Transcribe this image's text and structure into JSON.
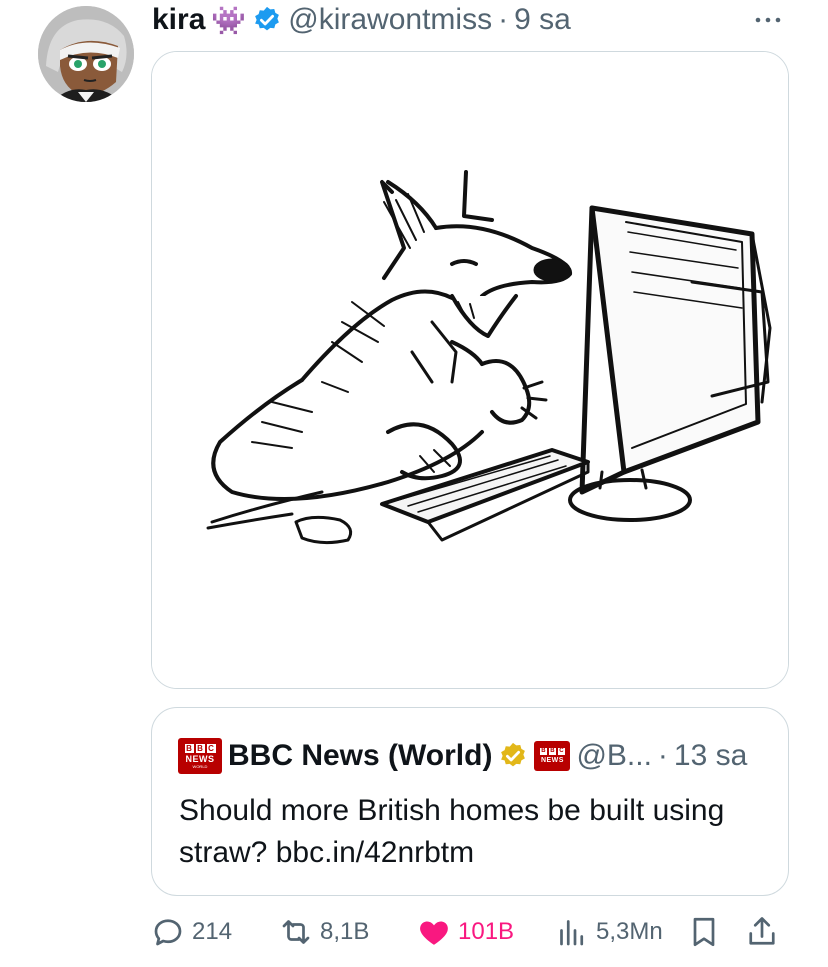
{
  "tweet": {
    "author_name": "kira",
    "author_emoji": "👾",
    "handle": "@kirawontmiss",
    "separator": "·",
    "time": "9 sa",
    "verified_color": "#1d9bf0"
  },
  "quote": {
    "author_name": "BBC News (World)",
    "handle": "@B...",
    "separator": "·",
    "time": "13 sa",
    "text": "Should more British homes be built using straw? bbc.in/42nrbtm",
    "verified_color": "#e2b719",
    "logo": {
      "blocks": [
        "B",
        "B",
        "C"
      ],
      "news": "NEWS",
      "sub": "WORLD"
    },
    "mini_logo": {
      "blocks": [
        "B",
        "B",
        "C"
      ],
      "news": "NEWS"
    }
  },
  "actions": {
    "replies": "214",
    "reposts": "8,1B",
    "likes": "101B",
    "views": "5,3Mn"
  },
  "colors": {
    "muted": "#536471",
    "like": "#f91880",
    "border": "#cfd9de",
    "bbc_red": "#b80000"
  }
}
